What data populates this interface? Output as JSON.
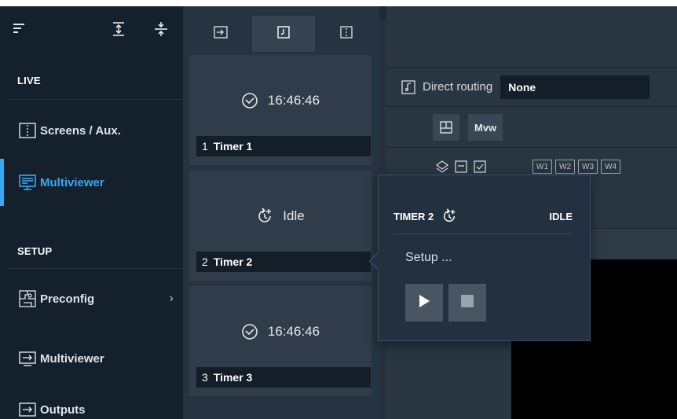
{
  "sidebar": {
    "sections": {
      "live": "LIVE",
      "setup": "SETUP"
    },
    "items": [
      {
        "label": "Screens / Aux.",
        "icon": "screens-icon"
      },
      {
        "label": "Multiviewer",
        "icon": "multiviewer-monitor-icon",
        "active": true
      },
      {
        "label": "Preconfig",
        "icon": "preconfig-icon",
        "chevron": "›"
      },
      {
        "label": "Multiviewer",
        "icon": "multiviewer-setup-icon"
      },
      {
        "label": "Outputs",
        "icon": "outputs-icon"
      }
    ],
    "top_icons": [
      "menu-icon",
      "expand-vertical-icon",
      "split-vertical-icon"
    ]
  },
  "panel": {
    "tabs": [
      {
        "icon": "input-tab-icon"
      },
      {
        "icon": "timer-tab-icon",
        "selected": true
      },
      {
        "icon": "layout-tab-icon"
      }
    ],
    "timers": [
      {
        "num": "1",
        "name": "Timer 1",
        "status": "16:46:46",
        "icon": "clock-icon"
      },
      {
        "num": "2",
        "name": "Timer 2",
        "status": "Idle",
        "icon": "timer-reset-icon"
      },
      {
        "num": "3",
        "name": "Timer 3",
        "status": "16:46:46",
        "icon": "clock-icon"
      }
    ]
  },
  "main": {
    "direct_routing": {
      "label": "Direct routing",
      "value": "None"
    },
    "mvw_label": "Mvw",
    "windows": [
      "W1",
      "W2",
      "W3",
      "W4"
    ]
  },
  "popup": {
    "title": "TIMER 2",
    "state": "IDLE",
    "setup": "Setup ...",
    "buttons": [
      "play-icon",
      "stop-icon"
    ]
  },
  "colors": {
    "accent": "#36a9f4",
    "sidebar_bg": "#14202c",
    "panel_bg": "#263341"
  }
}
